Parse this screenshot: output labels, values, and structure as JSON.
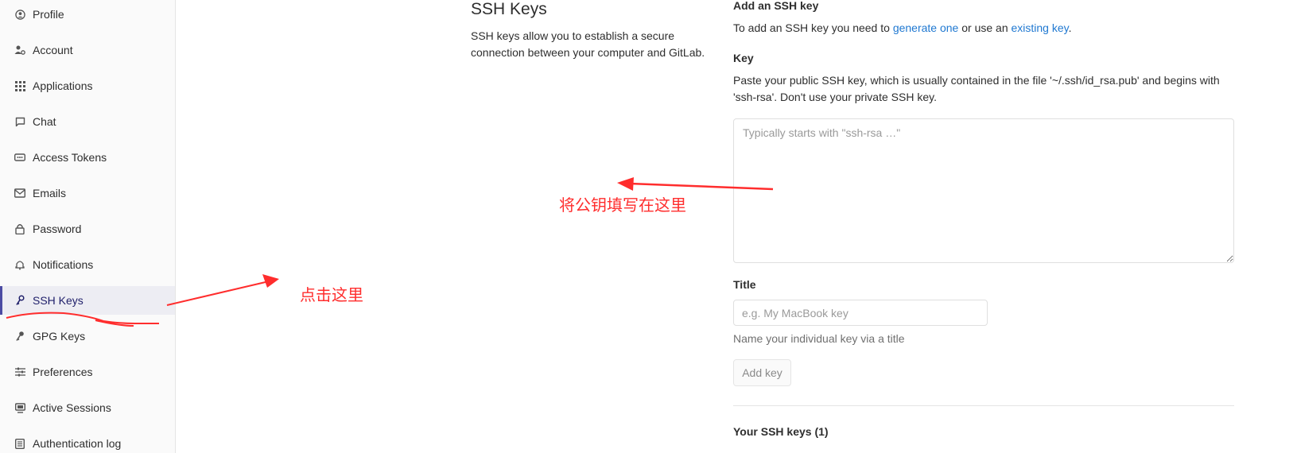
{
  "sidebar": {
    "items": [
      {
        "label": "Profile",
        "icon": "profile-icon"
      },
      {
        "label": "Account",
        "icon": "account-icon"
      },
      {
        "label": "Applications",
        "icon": "applications-icon"
      },
      {
        "label": "Chat",
        "icon": "chat-icon"
      },
      {
        "label": "Access Tokens",
        "icon": "access-tokens-icon"
      },
      {
        "label": "Emails",
        "icon": "email-icon"
      },
      {
        "label": "Password",
        "icon": "lock-icon"
      },
      {
        "label": "Notifications",
        "icon": "bell-icon"
      },
      {
        "label": "SSH Keys",
        "icon": "key-icon",
        "active": true
      },
      {
        "label": "GPG Keys",
        "icon": "key-icon"
      },
      {
        "label": "Preferences",
        "icon": "preferences-icon"
      },
      {
        "label": "Active Sessions",
        "icon": "monitor-icon"
      },
      {
        "label": "Authentication log",
        "icon": "log-icon"
      }
    ]
  },
  "section": {
    "title": "SSH Keys",
    "description": "SSH keys allow you to establish a secure connection between your computer and GitLab."
  },
  "form": {
    "heading": "Add an SSH key",
    "intro_prefix": "To add an SSH key you need to ",
    "intro_link1": "generate one",
    "intro_middle": " or use an ",
    "intro_link2": "existing key",
    "intro_suffix": ".",
    "key_label": "Key",
    "key_help": "Paste your public SSH key, which is usually contained in the file '~/.ssh/id_rsa.pub' and begins with 'ssh-rsa'. Don't use your private SSH key.",
    "key_placeholder": "Typically starts with \"ssh-rsa …\"",
    "title_label": "Title",
    "title_placeholder": "e.g. My MacBook key",
    "title_help": "Name your individual key via a title",
    "add_button": "Add key",
    "your_keys": "Your SSH keys (1)"
  },
  "annotations": {
    "click_here": "点击这里",
    "paste_here": "将公钥填写在这里",
    "color": "#ff2d2d"
  },
  "colors": {
    "link": "#1f78d1",
    "active_indicator": "#4b4ba3"
  }
}
